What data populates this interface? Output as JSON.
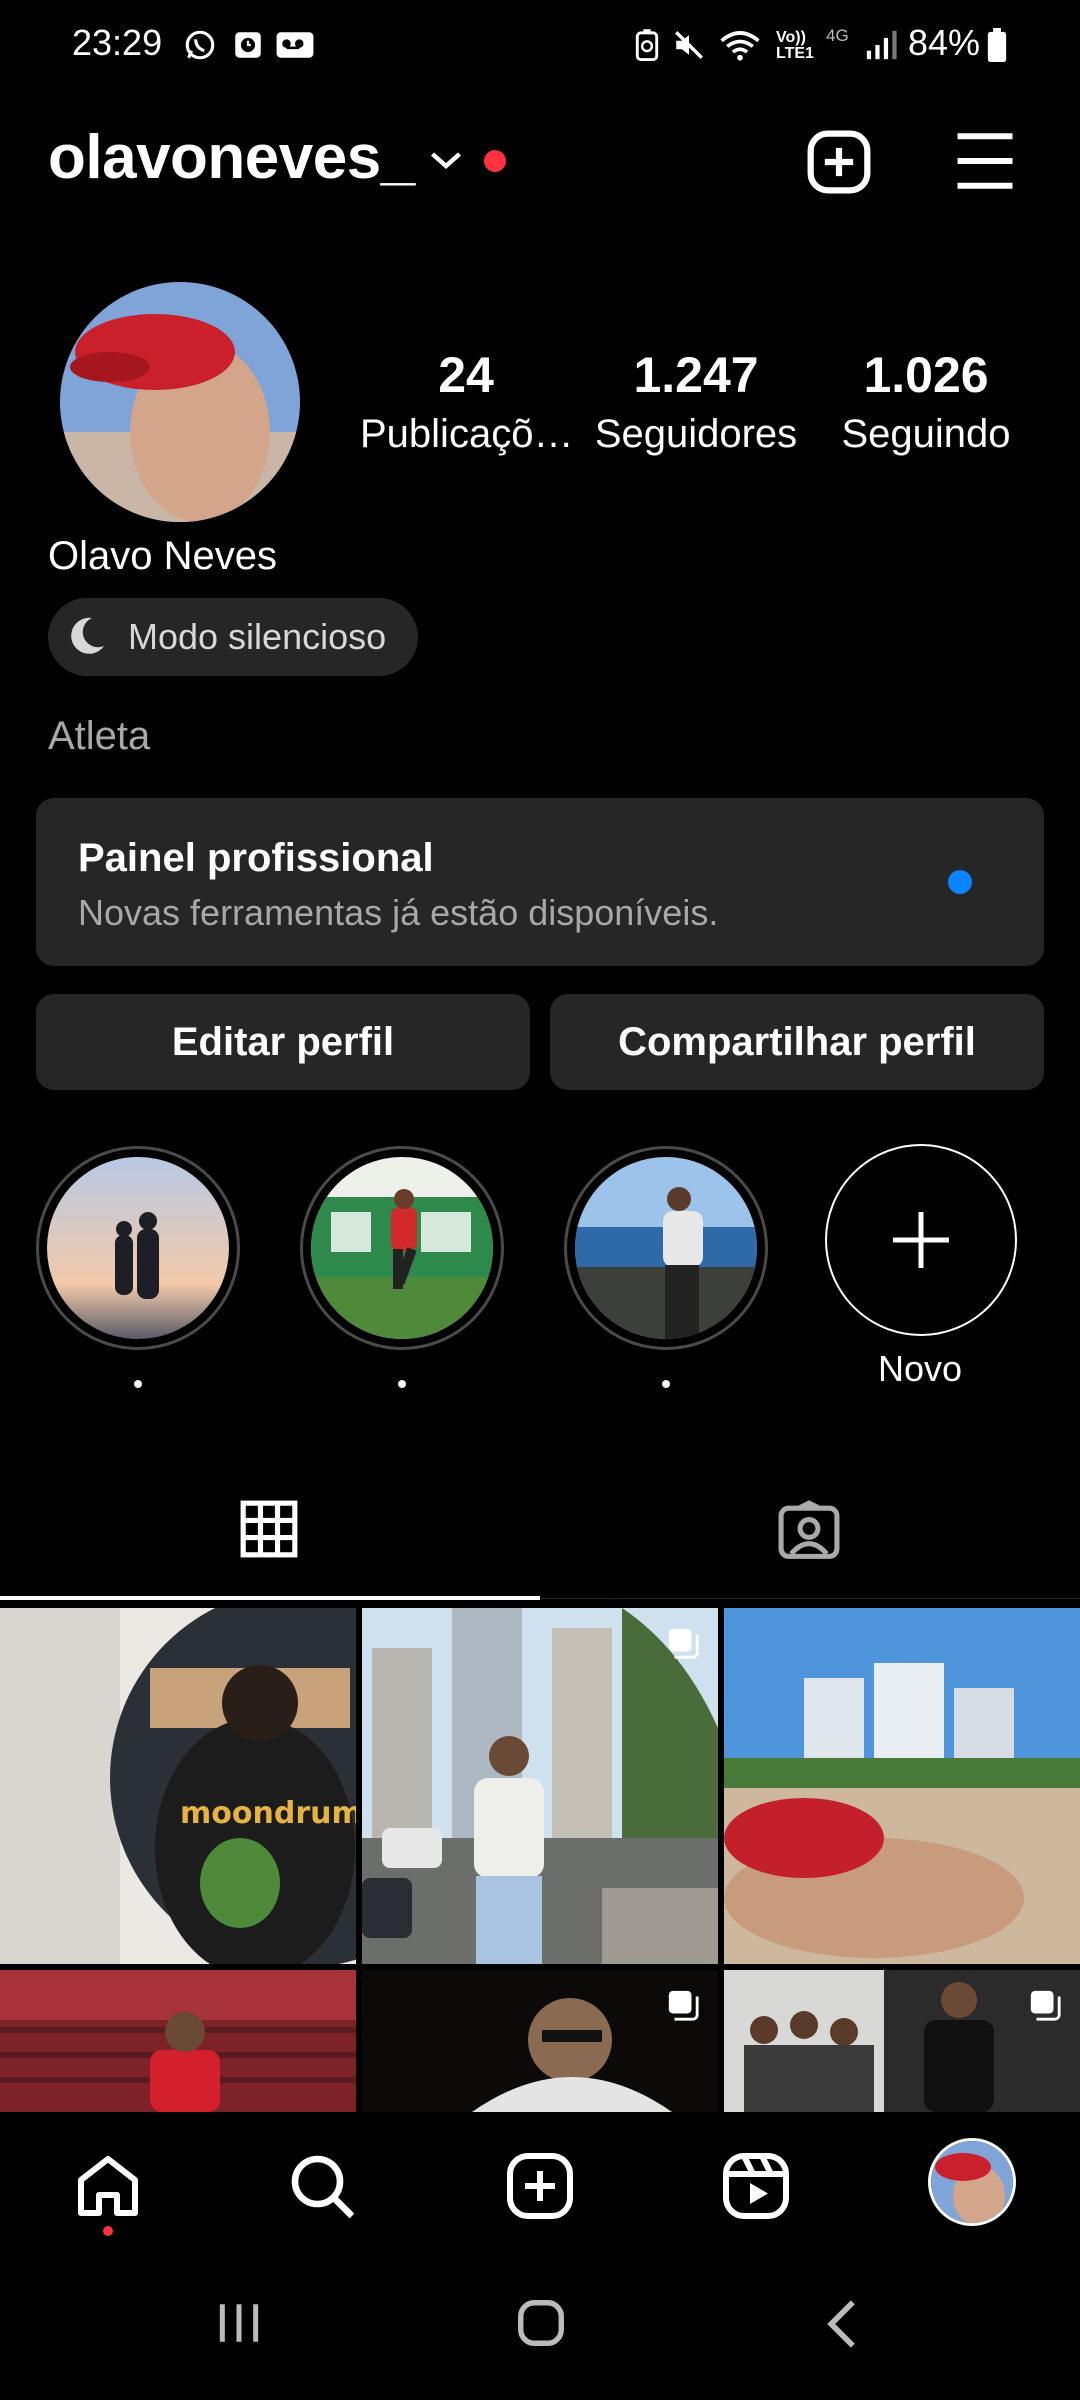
{
  "status_bar": {
    "time": "23:29",
    "battery": "84%",
    "network_label_top": "Vo))",
    "network_label_bottom": "LTE1",
    "network_type": "4G",
    "left_icons": [
      "whatsapp-icon",
      "alarm-icon",
      "voicemail-icon"
    ],
    "right_icons": [
      "battery-saver-icon",
      "mute-icon",
      "wifi-icon",
      "signal-icon",
      "battery-icon"
    ]
  },
  "header": {
    "username": "olavoneves_",
    "notification_color": "#ff3040"
  },
  "profile": {
    "display_name": "Olavo Neves",
    "quiet_mode": "Modo silencioso",
    "category": "Atleta",
    "stats": [
      {
        "value": "24",
        "label": "Publicaçõ…"
      },
      {
        "value": "1.247",
        "label": "Seguidores"
      },
      {
        "value": "1.026",
        "label": "Seguindo"
      }
    ]
  },
  "pro_panel": {
    "title": "Painel profissional",
    "subtitle": "Novas ferramentas já estão disponíveis.",
    "dot_color": "#0a84ff"
  },
  "actions": {
    "edit": "Editar perfil",
    "share": "Compartilhar perfil"
  },
  "highlights": {
    "items": [
      "highlight-1",
      "highlight-2",
      "highlight-3"
    ],
    "new_label": "Novo"
  },
  "tabs": [
    "grid-icon",
    "tagged-icon"
  ],
  "bottom_nav": [
    "home-icon",
    "search-icon",
    "create-icon",
    "reels-icon",
    "profile-avatar"
  ]
}
